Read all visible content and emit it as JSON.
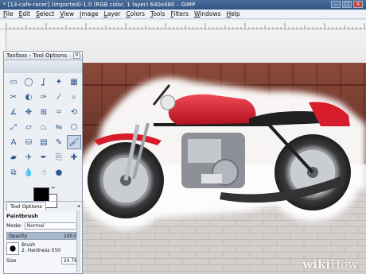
{
  "window": {
    "title": "* [13-cafe-racer] (imported)-1.0 (RGB color, 1 layer) 640x480 – GIMP"
  },
  "menu": [
    "File",
    "Edit",
    "Select",
    "View",
    "Image",
    "Layer",
    "Colors",
    "Tools",
    "Filters",
    "Windows",
    "Help"
  ],
  "toolbox": {
    "title": "Toolbox - Tool Options",
    "tools": [
      {
        "icon": "rect-select-icon",
        "glyph": "▭"
      },
      {
        "icon": "ellipse-select-icon",
        "glyph": "◯"
      },
      {
        "icon": "free-select-icon",
        "glyph": "ʆ"
      },
      {
        "icon": "fuzzy-select-icon",
        "glyph": "✦"
      },
      {
        "icon": "color-select-icon",
        "glyph": "▦"
      },
      {
        "icon": "scissors-icon",
        "glyph": "✂"
      },
      {
        "icon": "foreground-select-icon",
        "glyph": "◐"
      },
      {
        "icon": "paths-icon",
        "glyph": "✑"
      },
      {
        "icon": "color-picker-icon",
        "glyph": "⁄"
      },
      {
        "icon": "zoom-icon",
        "glyph": "⌕"
      },
      {
        "icon": "measure-icon",
        "glyph": "∡"
      },
      {
        "icon": "move-icon",
        "glyph": "✥"
      },
      {
        "icon": "align-icon",
        "glyph": "⊞"
      },
      {
        "icon": "crop-icon",
        "glyph": "⌗"
      },
      {
        "icon": "rotate-icon",
        "glyph": "⟲"
      },
      {
        "icon": "scale-icon",
        "glyph": "⤢"
      },
      {
        "icon": "shear-icon",
        "glyph": "▱"
      },
      {
        "icon": "perspective-icon",
        "glyph": "⏢"
      },
      {
        "icon": "flip-icon",
        "glyph": "⇋"
      },
      {
        "icon": "cage-icon",
        "glyph": "⬡"
      },
      {
        "icon": "text-icon",
        "glyph": "A"
      },
      {
        "icon": "bucket-fill-icon",
        "glyph": "⛁"
      },
      {
        "icon": "blend-icon",
        "glyph": "▤"
      },
      {
        "icon": "pencil-icon",
        "glyph": "✎"
      },
      {
        "icon": "paintbrush-icon",
        "glyph": "🖌"
      },
      {
        "icon": "eraser-icon",
        "glyph": "▰"
      },
      {
        "icon": "airbrush-icon",
        "glyph": "✈"
      },
      {
        "icon": "ink-icon",
        "glyph": "✒"
      },
      {
        "icon": "clone-icon",
        "glyph": "⎘"
      },
      {
        "icon": "heal-icon",
        "glyph": "✚"
      },
      {
        "icon": "perspective-clone-icon",
        "glyph": "⧉"
      },
      {
        "icon": "blur-icon",
        "glyph": "💧"
      },
      {
        "icon": "smudge-icon",
        "glyph": "☝"
      },
      {
        "icon": "dodge-burn-icon",
        "glyph": "●"
      }
    ],
    "active_tool_index": 24,
    "foreground_color": "#000000",
    "background_color": "#ffffff"
  },
  "tool_options": {
    "tab_label": "Tool Options",
    "title": "Paintbrush",
    "mode_label": "Mode:",
    "mode_value": "Normal",
    "opacity_label": "Opacity",
    "opacity_value": "100.0",
    "brush_label": "Brush",
    "brush_name": "2. Hardness 050",
    "size_label": "Size",
    "size_value": "20.78"
  },
  "watermark": {
    "part1": "wiki",
    "part2": "How"
  },
  "colors": {
    "titlebar": "#3a5f8f",
    "bike_red": "#d81c2c",
    "fence": "#7a3d2f",
    "selection_glow": "#ffffff"
  }
}
